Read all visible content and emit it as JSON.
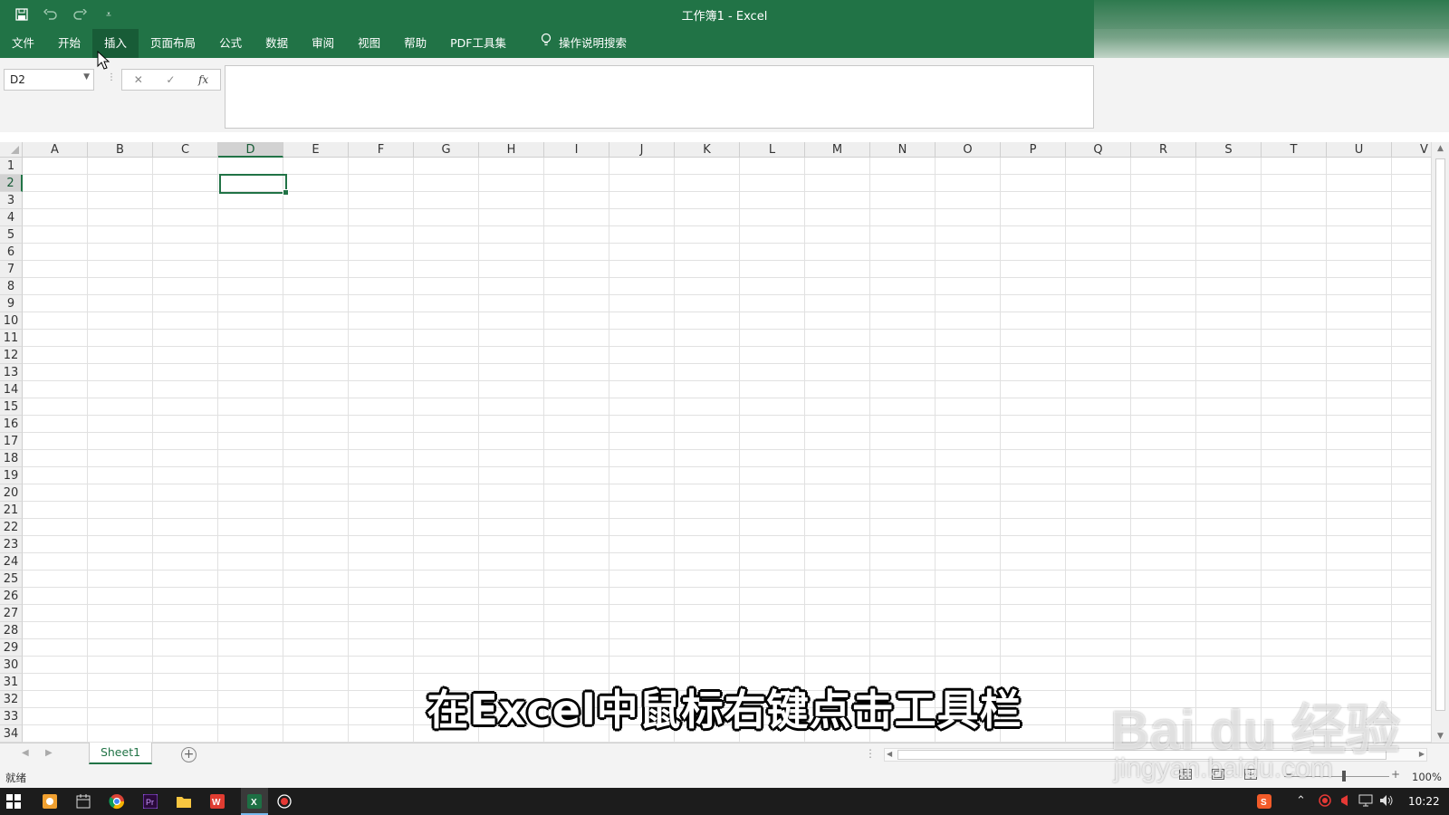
{
  "window": {
    "title": "工作簿1  -  Excel",
    "accent_color": "#217346"
  },
  "quick_access": {
    "icons": [
      "save-icon",
      "undo-icon",
      "redo-icon",
      "customize-icon"
    ],
    "customize_glyph": "⩡"
  },
  "ribbon": {
    "tabs": [
      {
        "label": "文件",
        "active": false
      },
      {
        "label": "开始",
        "active": false
      },
      {
        "label": "插入",
        "active": true
      },
      {
        "label": "页面布局",
        "active": false
      },
      {
        "label": "公式",
        "active": false
      },
      {
        "label": "数据",
        "active": false
      },
      {
        "label": "审阅",
        "active": false
      },
      {
        "label": "视图",
        "active": false
      },
      {
        "label": "帮助",
        "active": false
      },
      {
        "label": "PDF工具集",
        "active": false
      }
    ],
    "search_label": "操作说明搜索"
  },
  "formula_bar": {
    "name_box_value": "D2",
    "formula_value": "",
    "cancel_glyph": "✕",
    "enter_glyph": "✓",
    "fx_label": "fx"
  },
  "grid": {
    "columns": [
      "A",
      "B",
      "C",
      "D",
      "E",
      "F",
      "G",
      "H",
      "I",
      "J",
      "K",
      "L",
      "M",
      "N",
      "O",
      "P",
      "Q",
      "R",
      "S",
      "T",
      "U",
      "V"
    ],
    "rows": [
      "1",
      "2",
      "3",
      "4",
      "5",
      "6",
      "7",
      "8",
      "9",
      "10",
      "11",
      "12",
      "13",
      "14",
      "15",
      "16",
      "17",
      "18",
      "19",
      "20",
      "21",
      "22",
      "23",
      "24",
      "25",
      "26",
      "27",
      "28",
      "29",
      "30",
      "31",
      "32",
      "33",
      "34"
    ],
    "selected_column": "D",
    "selected_row": "2"
  },
  "sheets": {
    "tabs": [
      "Sheet1"
    ],
    "add_label": "+"
  },
  "status": {
    "text": "就绪",
    "zoom_level": "100%",
    "zoom_minus": "−",
    "zoom_plus": "+"
  },
  "taskbar": {
    "clock": "10:22",
    "apps": [
      "windows-start-icon",
      "media-player-icon",
      "calendar-icon",
      "chrome-icon",
      "premiere-icon",
      "file-explorer-icon",
      "wps-icon",
      "excel-icon",
      "screen-recorder-icon"
    ]
  },
  "overlay": {
    "subtitle": "在Excel中鼠标右键点击工具栏",
    "watermark_brand": "Bai du 经验",
    "watermark_url": "jingyan.baidu.com"
  }
}
